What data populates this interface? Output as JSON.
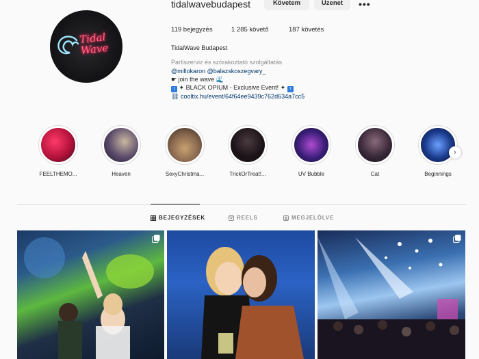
{
  "profile": {
    "username": "tidalwavebudapest",
    "logo_text": "Tidal Wave",
    "follow_button": "Követem",
    "message_button": "Üzenet",
    "more_icon": "more-horizontal-icon"
  },
  "stats": {
    "posts": "119 bejegyzés",
    "followers": "1 285 követő",
    "following": "187 követés"
  },
  "bio": {
    "name": "TidalWave Budapest",
    "category": "Partiszerviz és szórakoztató szolgáltatás",
    "mentions": "@millokaron @balazskoszegvary_",
    "line_wave": "join the wave",
    "line_event": "BLACK OPIUM - Exclusive Event!",
    "link": "cooltix.hu/event/64f64ee9439c762d634a7cc5"
  },
  "highlights": [
    {
      "label": "FEELTHEMO...",
      "color": "#b3123a"
    },
    {
      "label": "Heaven",
      "color": "#5a4a6a"
    },
    {
      "label": "SexyChristma...",
      "color": "#8a6a50"
    },
    {
      "label": "TrickOrTreat!...",
      "color": "#1a1216"
    },
    {
      "label": "UV Bubble",
      "color": "#3b1f7a"
    },
    {
      "label": "Cat",
      "color": "#3a2a3a"
    },
    {
      "label": "Beginnings",
      "color": "#1a3a8a"
    }
  ],
  "tabs": {
    "posts": "BEJEGYZÉSEK",
    "reels": "REELS",
    "tagged": "MEGJELÖLVE"
  },
  "colors": {
    "link": "#00376b",
    "secondary_text": "#8e8e8e",
    "button_bg": "#efefef"
  }
}
